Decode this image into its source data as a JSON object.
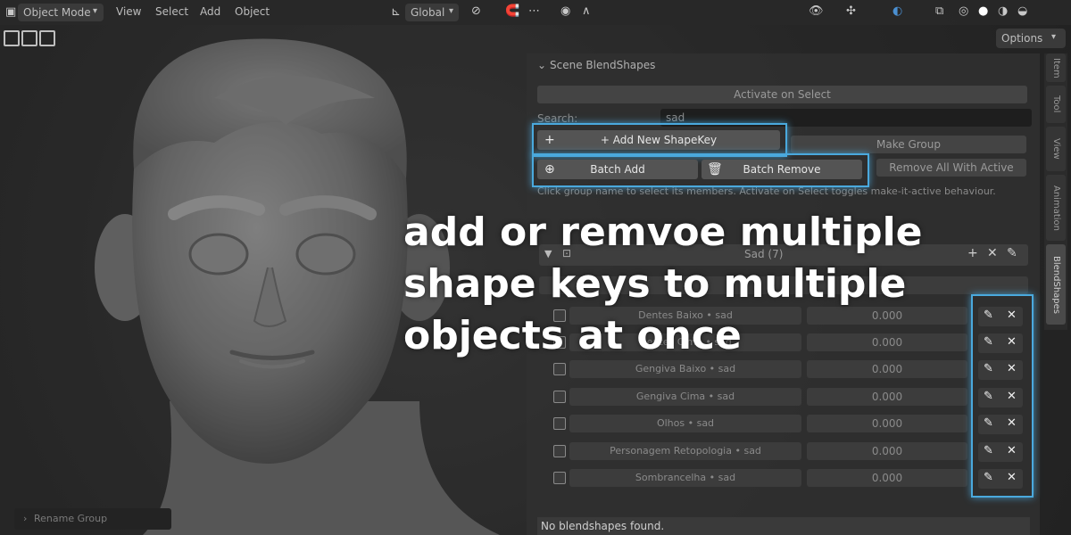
{
  "header": {
    "mode_label": "Object Mode",
    "menu": [
      "View",
      "Select",
      "Add",
      "Object"
    ],
    "transform_orientation": "Global",
    "options_label": "Options"
  },
  "side_tabs": [
    "Item",
    "Tool",
    "View",
    "Animation",
    "BlendShapes"
  ],
  "panel": {
    "title": "Scene BlendShapes",
    "activate_button": "Activate on Select",
    "search_label": "Search:",
    "search_value": "sad",
    "add_shapekey_button": "+ Add New ShapeKey",
    "make_group_button": "Make Group",
    "batch_add_button": "Batch Add",
    "batch_remove_button": "Batch Remove",
    "remove_all_button": "Remove All With Active",
    "hint": "Click group name to select its members. Activate on Select toggles make-it-active behaviour.",
    "group_title": "Sad (7)",
    "items": [
      {
        "name": "Dentes Baixo • sad",
        "value": "0.000"
      },
      {
        "name": "Dentes Cima • sad",
        "value": "0.000"
      },
      {
        "name": "Gengiva Baixo • sad",
        "value": "0.000"
      },
      {
        "name": "Gengiva Cima • sad",
        "value": "0.000"
      },
      {
        "name": "Olhos • sad",
        "value": "0.000"
      },
      {
        "name": "Personagem Retopologia • sad",
        "value": "0.000"
      },
      {
        "name": "Sombrancelha • sad",
        "value": "0.000"
      }
    ],
    "footer_text": "No blendshapes found."
  },
  "overlay_caption": [
    "add or remvoe multiple",
    "shape keys to multiple",
    "objects at once"
  ],
  "rename_group_label": "Rename Group",
  "colors": {
    "highlight": "#4aa9dd",
    "background": "#2b2b2b"
  }
}
